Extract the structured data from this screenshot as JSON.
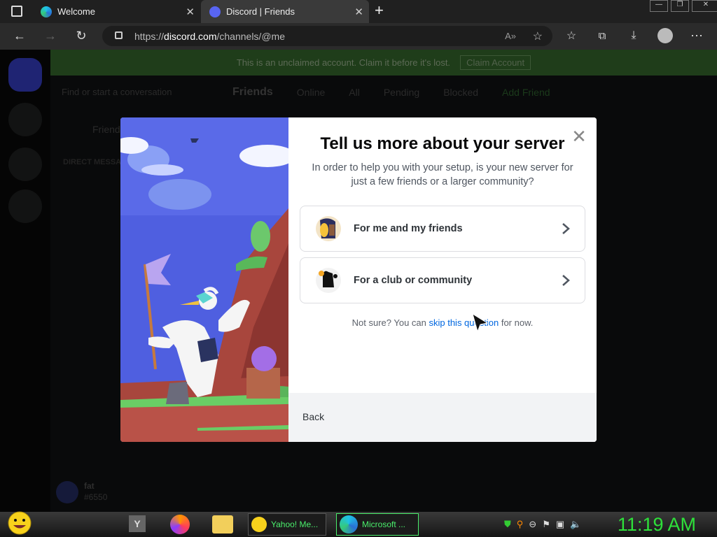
{
  "browser": {
    "tabs": [
      {
        "title": "Welcome",
        "close": "✕"
      },
      {
        "title": "Discord | Friends",
        "close": "✕"
      }
    ],
    "new_tab": "+",
    "url_prefix": "https://",
    "url_domain": "discord.com",
    "url_path": "/channels/@me",
    "window_controls": {
      "minimize": "—",
      "restore": "❐",
      "close": "✕"
    }
  },
  "discord": {
    "banner_text": "This is an unclaimed account. Claim it before it's lost.",
    "claim_button": "Claim Account",
    "search_placeholder": "Find or start a conversation",
    "friends_title": "Friends",
    "friends_tabs": [
      "Online",
      "All",
      "Pending",
      "Blocked"
    ],
    "add_friend": "Add Friend",
    "dm_friends": "Friends",
    "direct_messages": "DIRECT MESSAGES",
    "username": "fat",
    "discriminator": "#6550"
  },
  "modal": {
    "title": "Tell us more about your server",
    "subtitle": "In order to help you with your setup, is your new server for just a few friends or a larger community?",
    "options": [
      {
        "label": "For me and my friends",
        "icon": "friends-icon"
      },
      {
        "label": "For a club or community",
        "icon": "community-icon"
      }
    ],
    "not_sure_prefix": "Not sure? You can ",
    "skip_link": "skip this question",
    "not_sure_suffix": " for now.",
    "back": "Back",
    "close": "✕"
  },
  "taskbar": {
    "yahoo_label": "Yahoo! Me...",
    "edge_label": "Microsoft ...",
    "y_label": "Y",
    "clock": "11:19 AM"
  },
  "colors": {
    "accent": "#5865f2",
    "link": "#0067e0",
    "clock": "#2ee03a"
  }
}
